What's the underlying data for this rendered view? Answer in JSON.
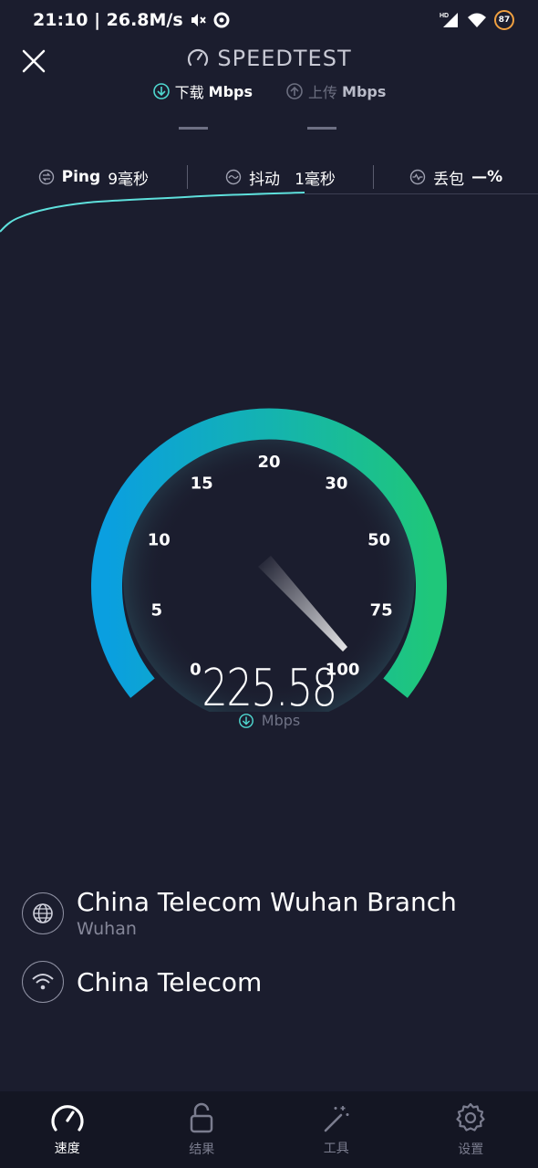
{
  "status_bar": {
    "time_speed": "21:10 | 26.8M/s",
    "battery": "87"
  },
  "app": {
    "title": "SPEEDTEST"
  },
  "units": {
    "download_label": "下载",
    "upload_label": "上传",
    "unit": "Mbps"
  },
  "stats": {
    "ping_label": "Ping",
    "ping_value": "9毫秒",
    "jitter_label": "抖动",
    "jitter_value": "1毫秒",
    "loss_label": "丢包",
    "loss_value": "—%"
  },
  "gauge": {
    "scale": [
      "0",
      "5",
      "10",
      "15",
      "20",
      "30",
      "50",
      "75",
      "100"
    ],
    "speed": "225.58",
    "speed_unit": "Mbps",
    "colors": {
      "start": "#0a9fe0",
      "mid": "#14b3b0",
      "end": "#1fc77a"
    }
  },
  "server": {
    "name": "China Telecom Wuhan Branch",
    "location": "Wuhan"
  },
  "provider": {
    "name": "China Telecom"
  },
  "nav": {
    "items": [
      {
        "label": "速度",
        "icon": "speedometer-icon",
        "active": true
      },
      {
        "label": "结果",
        "icon": "unlock-icon",
        "active": false
      },
      {
        "label": "工具",
        "icon": "magic-wand-icon",
        "active": false
      },
      {
        "label": "设置",
        "icon": "gear-icon",
        "active": false
      }
    ]
  }
}
